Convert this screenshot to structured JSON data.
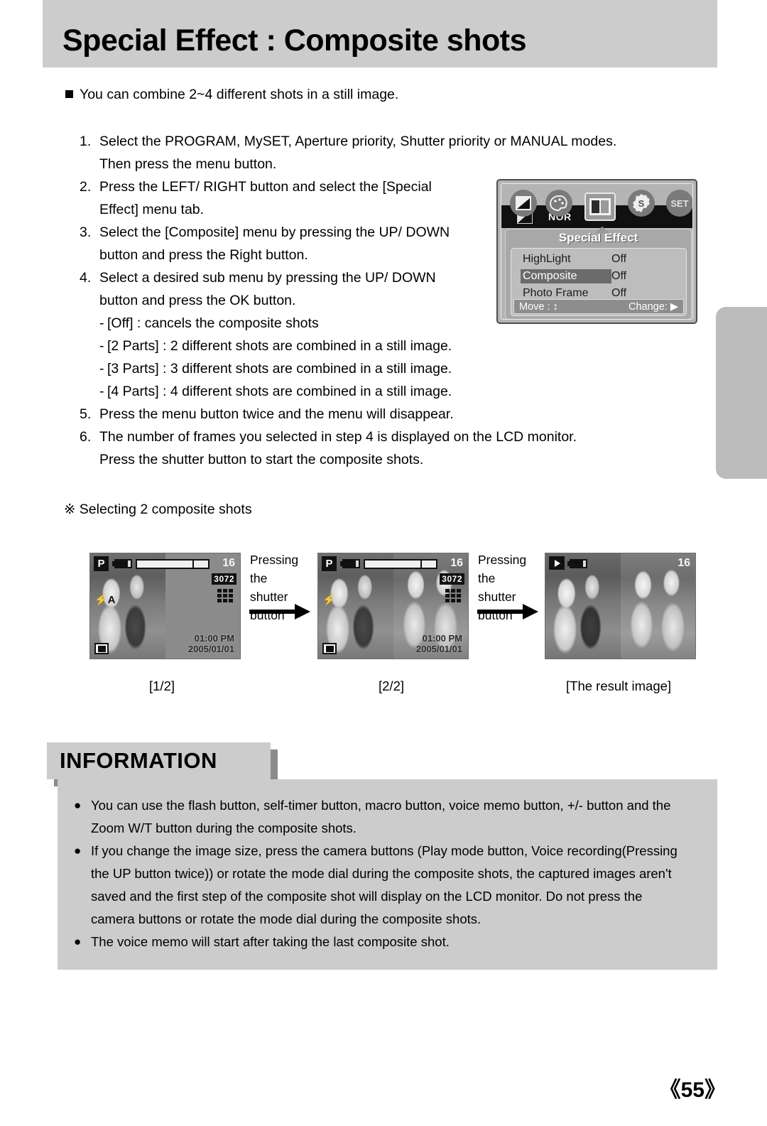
{
  "header": {
    "title": "Special Effect : Composite shots"
  },
  "intro": "You can combine 2~4 different shots in a still image.",
  "steps": [
    {
      "num": "1.",
      "lines": [
        "Select the PROGRAM, MySET, Aperture priority, Shutter priority or MANUAL modes.",
        "Then press the menu button."
      ]
    },
    {
      "num": "2.",
      "lines": [
        "Press the LEFT/ RIGHT button and select the [Special",
        "Effect] menu tab."
      ]
    },
    {
      "num": "3.",
      "lines": [
        "Select the [Composite] menu by pressing the UP/ DOWN",
        "button and press the Right button."
      ]
    },
    {
      "num": "4.",
      "lines": [
        "Select a desired sub menu by pressing the UP/ DOWN",
        "button and press the OK button."
      ]
    }
  ],
  "sub_items": [
    "[Off] : cancels the composite shots",
    "[2 Parts] : 2 different shots are combined in a still image.",
    "[3 Parts] : 3 different shots are combined in a still image.",
    "[4 Parts] : 4 different shots are combined in a still image."
  ],
  "steps_tail": [
    {
      "num": "5.",
      "lines": [
        "Press the menu button twice and the menu will disappear."
      ]
    },
    {
      "num": "6.",
      "lines": [
        "The number of frames you selected in step 4 is displayed on the LCD monitor.",
        "Press the shutter button to start the composite shots."
      ]
    }
  ],
  "lcd_menu": {
    "title": "Special Effect",
    "nor_label": "NOR",
    "tabs": [
      "contrast-icon",
      "palette-icon",
      "composite-icon",
      "sharpness-icon",
      "set-icon"
    ],
    "set_label": "SET",
    "rows": [
      {
        "label": "HighLight",
        "value": "Off",
        "selected": false
      },
      {
        "label": "Composite",
        "value": "Off",
        "selected": true
      },
      {
        "label": "Photo Frame",
        "value": "Off",
        "selected": false
      }
    ],
    "footer_move": "Move :",
    "footer_move_glyph": "↕",
    "footer_change": "Change:",
    "footer_change_glyph": "▶"
  },
  "sequence": {
    "heading_mark": "※",
    "heading": "Selecting 2 composite shots",
    "arrow_labels": [
      "Pressing the\nshutter button",
      "Pressing the\nshutter button"
    ],
    "arrow_label_line1": "Pressing the",
    "arrow_label_line2": "shutter button",
    "captions": [
      "[1/2]",
      "[2/2]",
      "[The result image]"
    ],
    "osd": {
      "mode": "P",
      "count": "16",
      "resolution": "3072",
      "time": "01:00 PM",
      "date": "2005/01/01",
      "flash": "⚡A",
      "flash_second": "⚡"
    }
  },
  "information": {
    "tab_label": "INFORMATION",
    "bullet": "●",
    "items": [
      "You can use the flash button, self-timer button, macro button, voice memo button, +/- button and the Zoom W/T button during the composite shots.",
      "If you change the image size, press the camera buttons (Play mode button, Voice recording(Pressing the UP button twice)) or rotate the mode dial during the composite shots, the captured images aren't saved and the first step of the composite shot will display on the LCD monitor. Do not press the camera buttons or rotate the mode dial during the composite shots.",
      "The voice memo will start after taking the last composite shot."
    ]
  },
  "page_number": "《55》"
}
